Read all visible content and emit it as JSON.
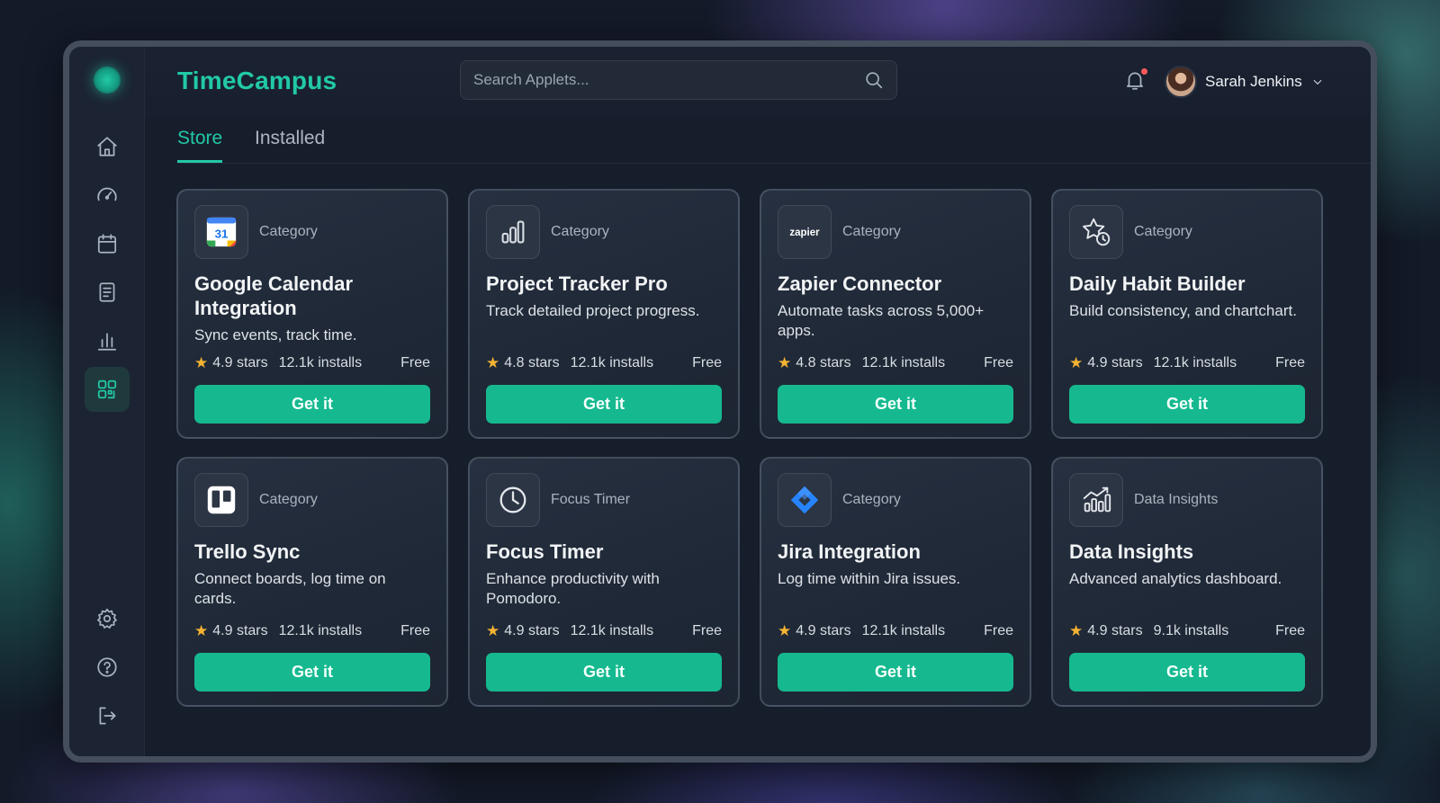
{
  "app": {
    "brand": "TimeCampus"
  },
  "search": {
    "placeholder": "Search Applets..."
  },
  "user": {
    "name": "Sarah Jenkins",
    "notifications_unread": true
  },
  "tabs": [
    {
      "label": "Store",
      "active": true
    },
    {
      "label": "Installed",
      "active": false
    }
  ],
  "sidebar": {
    "items": [
      {
        "icon": "home-icon"
      },
      {
        "icon": "dashboard-gauge-icon"
      },
      {
        "icon": "calendar-icon"
      },
      {
        "icon": "document-icon"
      },
      {
        "icon": "bar-chart-icon"
      },
      {
        "icon": "apps-grid-icon",
        "active": true
      }
    ],
    "bottom": [
      {
        "icon": "gear-icon"
      },
      {
        "icon": "help-icon"
      },
      {
        "icon": "logout-icon"
      }
    ]
  },
  "cards": [
    {
      "icon": "google-calendar-icon",
      "category": "Category",
      "title": "Google Calendar Integration",
      "desc": "Sync events, track time.",
      "rating": "4.9 stars",
      "installs": "12.1k installs",
      "price": "Free",
      "cta": "Get it"
    },
    {
      "icon": "bar-chart-icon",
      "category": "Category",
      "title": "Project Tracker Pro",
      "desc": "Track detailed project progress.",
      "rating": "4.8 stars",
      "installs": "12.1k installs",
      "price": "Free",
      "cta": "Get it"
    },
    {
      "icon": "zapier-logo",
      "category": "Category",
      "title": "Zapier Connector",
      "desc": "Automate tasks across 5,000+ apps.",
      "rating": "4.8 stars",
      "installs": "12.1k installs",
      "price": "Free",
      "cta": "Get it"
    },
    {
      "icon": "star-clock-icon",
      "category": "Category",
      "title": "Daily Habit Builder",
      "desc": "Build consistency, and chartchart.",
      "rating": "4.9 stars",
      "installs": "12.1k installs",
      "price": "Free",
      "cta": "Get it"
    },
    {
      "icon": "trello-icon",
      "category": "Category",
      "title": "Trello Sync",
      "desc": "Connect boards, log time on cards.",
      "rating": "4.9 stars",
      "installs": "12.1k installs",
      "price": "Free",
      "cta": "Get it"
    },
    {
      "icon": "clock-icon",
      "category": "Focus Timer",
      "title": "Focus Timer",
      "desc": "Enhance productivity with Pomodoro.",
      "rating": "4.9 stars",
      "installs": "12.1k installs",
      "price": "Free",
      "cta": "Get it"
    },
    {
      "icon": "jira-icon",
      "category": "Category",
      "title": "Jira Integration",
      "desc": "Log time within Jira issues.",
      "rating": "4.9 stars",
      "installs": "12.1k installs",
      "price": "Free",
      "cta": "Get it"
    },
    {
      "icon": "analytics-chart-icon",
      "category": "Data Insights",
      "title": "Data Insights",
      "desc": "Advanced analytics dashboard.",
      "rating": "4.9 stars",
      "installs": "9.1k installs",
      "price": "Free",
      "cta": "Get it"
    }
  ],
  "colors": {
    "accent": "#22c9a6",
    "button": "#16b98f",
    "star": "#f5b332"
  }
}
